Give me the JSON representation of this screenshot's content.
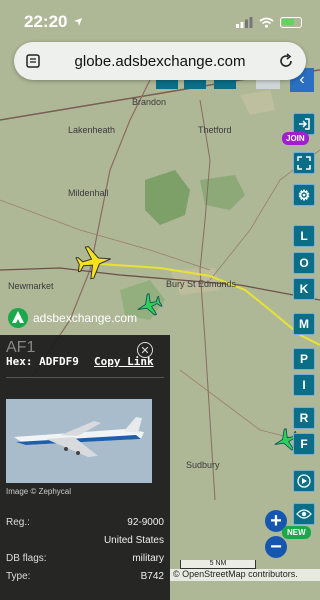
{
  "status": {
    "time": "22:20"
  },
  "browser": {
    "url": "globe.adsbexchange.com"
  },
  "map": {
    "towns": {
      "brandon": "Brandon",
      "thetford": "Thetford",
      "lakenheath": "Lakenheath",
      "mildenhall": "Mildenhall",
      "newmarket": "Newmarket",
      "bury": "Bury St Edmunds",
      "sudbury": "Sudbury"
    },
    "track_color": "#e8e332",
    "selected_aircraft_color": "#f7e21a",
    "other_aircraft_color": "#2bd15a"
  },
  "toolbar": {
    "join_label": "JOIN",
    "new_label": "NEW",
    "letters": {
      "l": "L",
      "o": "O",
      "k": "K",
      "m": "M",
      "p": "P",
      "i": "I",
      "r": "R",
      "f": "F"
    },
    "zoom_in": "+",
    "zoom_out": "−"
  },
  "logo": {
    "text": "adsbexchange.com"
  },
  "panel": {
    "callsign": "AF1",
    "hex_label": "Hex:",
    "hex": "ADFDF9",
    "copy_link": "Copy Link",
    "photo_credit": "Image © Zephycal",
    "fields": {
      "reg_label": "Reg.:",
      "reg_value": "92-9000",
      "country": "United States",
      "db_flags_label": "DB flags:",
      "db_flags_value": "military",
      "type_label": "Type:",
      "type_value": "B742"
    }
  },
  "scale": {
    "label": "5 NM"
  },
  "attribution": {
    "text": "© OpenStreetMap contributors."
  }
}
